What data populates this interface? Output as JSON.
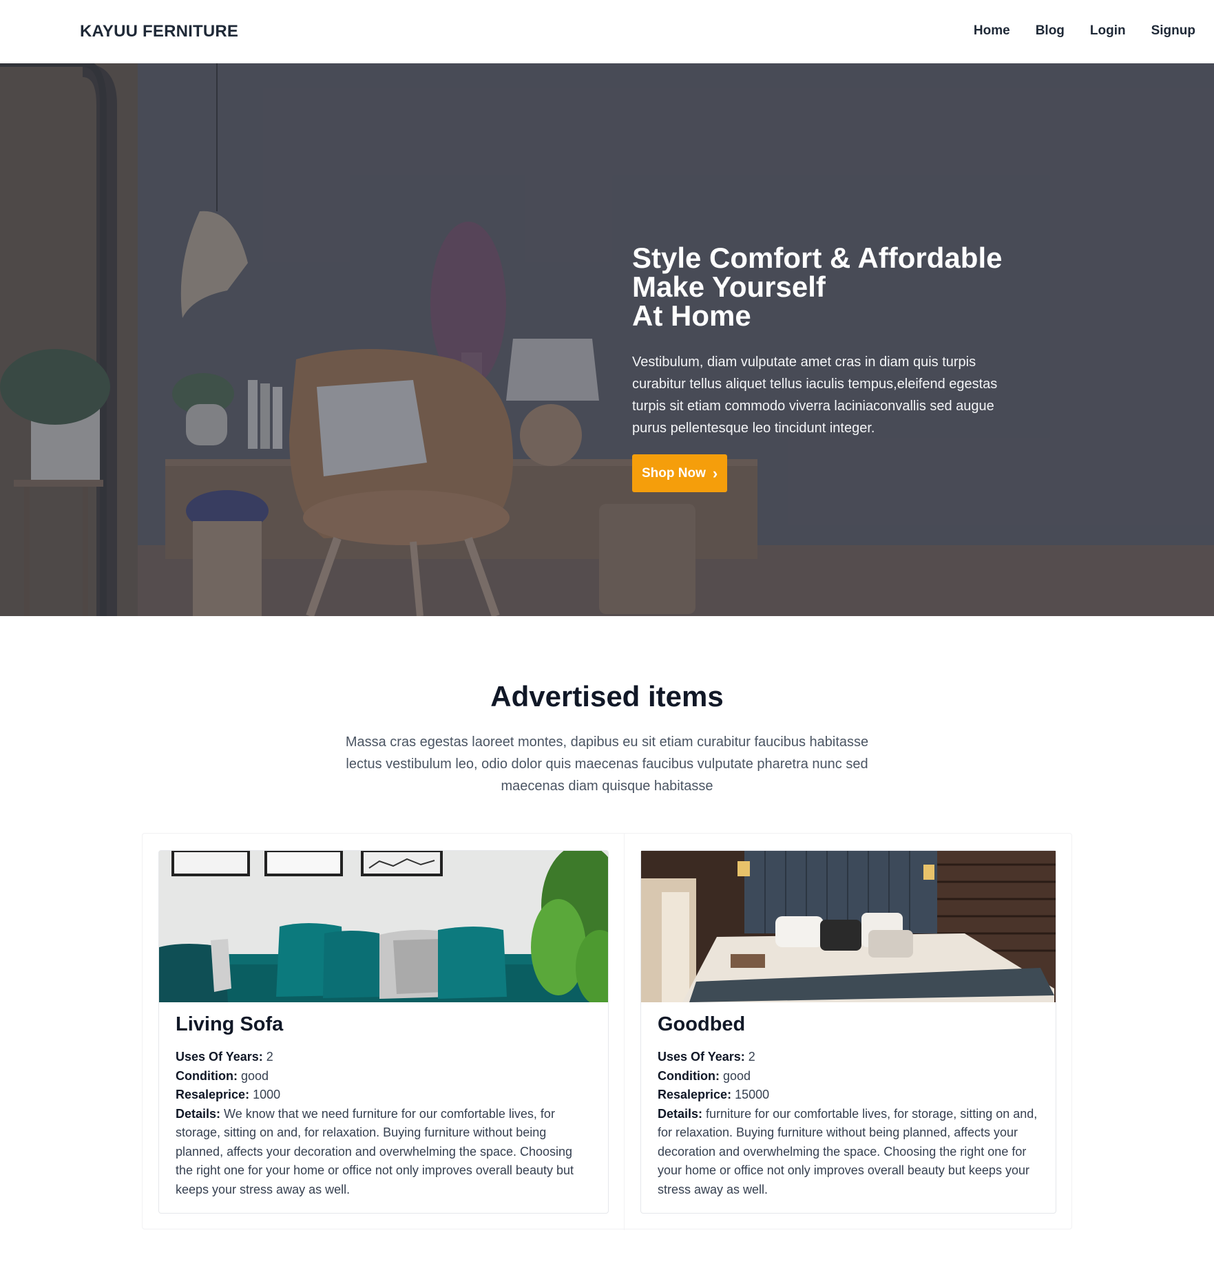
{
  "navbar": {
    "brand": "KAYUU FERNITURE",
    "links": [
      "Home",
      "Blog",
      "Login",
      "Signup"
    ]
  },
  "hero": {
    "title_lines": [
      "Style Comfort & Affordable",
      "Make Yourself",
      "At Home"
    ],
    "text": "Vestibulum, diam vulputate amet cras in diam quis turpis curabitur tellus aliquet tellus iaculis tempus,eleifend egestas turpis sit etiam commodo viverra laciniaconvallis sed augue purus pellentesque leo tincidunt integer.",
    "button_label": "Shop Now",
    "button_color": "#f59e0b"
  },
  "advertised": {
    "title": "Advertised items",
    "text": "Massa cras egestas laoreet montes, dapibus eu sit etiam curabitur faucibus habitasse lectus vestibulum leo, odio dolor quis maecenas faucibus vulputate pharetra nunc sed maecenas diam quisque habitasse",
    "labels": {
      "years": "Uses Of Years:",
      "condition": "Condition:",
      "price": "Resaleprice:",
      "details": "Details:"
    },
    "items": [
      {
        "name": "Living Sofa",
        "years": "2",
        "condition": "good",
        "price": "1000",
        "details": "We know that we need furniture for our comfortable lives, for storage, sitting on and, for relaxation. Buying furniture without being planned, affects your decoration and overwhelming the space. Choosing the right one for your home or office not only improves overall beauty but keeps your stress away as well."
      },
      {
        "name": "Goodbed",
        "years": "2",
        "condition": "good",
        "price": "15000",
        "details": "furniture for our comfortable lives, for storage, sitting on and, for relaxation. Buying furniture without being planned, affects your decoration and overwhelming the space. Choosing the right one for your home or office not only improves overall beauty but keeps your stress away as well."
      }
    ]
  }
}
